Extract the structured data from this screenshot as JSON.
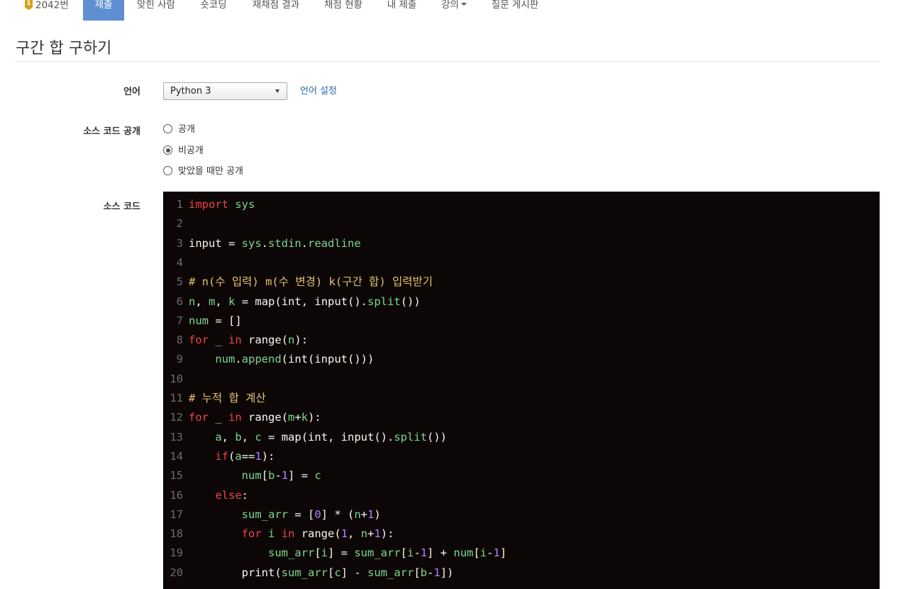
{
  "nav": {
    "problem_number": "2042번",
    "medal_text": "1",
    "items": [
      {
        "label": "제출",
        "active": true
      },
      {
        "label": "맞힌 사람"
      },
      {
        "label": "숏코딩"
      },
      {
        "label": "재채점 결과"
      },
      {
        "label": "채점 현황"
      },
      {
        "label": "내 제출"
      },
      {
        "label": "강의"
      },
      {
        "label": "질문 게시판"
      }
    ]
  },
  "page": {
    "title": "구간 합 구하기"
  },
  "form": {
    "language_label": "언어",
    "language_value": "Python 3",
    "language_settings_link": "언어 설정",
    "source_visibility_label": "소스 코드 공개",
    "visibility_options": [
      {
        "label": "공개",
        "checked": false
      },
      {
        "label": "비공개",
        "checked": true
      },
      {
        "label": "맞았을 때만 공개",
        "checked": false
      }
    ],
    "source_code_label": "소스 코드"
  },
  "code_lines": [
    {
      "n": "1",
      "segs": [
        [
          "import",
          "kw"
        ],
        [
          " "
        ],
        [
          "sys",
          "v"
        ]
      ]
    },
    {
      "n": "2",
      "segs": []
    },
    {
      "n": "3",
      "segs": [
        [
          "input = "
        ],
        [
          "sys",
          "v"
        ],
        [
          "."
        ],
        [
          "stdin",
          "v"
        ],
        [
          "."
        ],
        [
          "readline",
          "v"
        ]
      ]
    },
    {
      "n": "4",
      "segs": []
    },
    {
      "n": "5",
      "segs": [
        [
          "# n(수 입력) m(수 변경) k(구간 합) 입력받기",
          "cm"
        ]
      ]
    },
    {
      "n": "6",
      "segs": [
        [
          "n",
          "v"
        ],
        [
          ", "
        ],
        [
          "m",
          "v"
        ],
        [
          ", "
        ],
        [
          "k",
          "v"
        ],
        [
          " = map(int, input()."
        ],
        [
          "split",
          "v"
        ],
        [
          "())"
        ]
      ]
    },
    {
      "n": "7",
      "segs": [
        [
          "num",
          "v"
        ],
        [
          " = []"
        ]
      ]
    },
    {
      "n": "8",
      "segs": [
        [
          "for",
          "kw"
        ],
        [
          " "
        ],
        [
          "_",
          "v"
        ],
        [
          " "
        ],
        [
          "in",
          "kw"
        ],
        [
          " range("
        ],
        [
          "n",
          "v"
        ],
        [
          "):"
        ]
      ]
    },
    {
      "n": "9",
      "segs": [
        [
          "    "
        ],
        [
          "num",
          "v"
        ],
        [
          "."
        ],
        [
          "append",
          "v"
        ],
        [
          "(int(input()))"
        ]
      ]
    },
    {
      "n": "10",
      "segs": []
    },
    {
      "n": "11",
      "segs": [
        [
          "# 누적 합 계산",
          "cm"
        ]
      ]
    },
    {
      "n": "12",
      "segs": [
        [
          "for",
          "kw"
        ],
        [
          " "
        ],
        [
          "_",
          "v"
        ],
        [
          " "
        ],
        [
          "in",
          "kw"
        ],
        [
          " range("
        ],
        [
          "m",
          "v"
        ],
        [
          "+"
        ],
        [
          "k",
          "v"
        ],
        [
          "):"
        ]
      ]
    },
    {
      "n": "13",
      "segs": [
        [
          "    "
        ],
        [
          "a",
          "v"
        ],
        [
          ", "
        ],
        [
          "b",
          "v"
        ],
        [
          ", "
        ],
        [
          "c",
          "v"
        ],
        [
          " = map(int, input()."
        ],
        [
          "split",
          "v"
        ],
        [
          "())"
        ]
      ]
    },
    {
      "n": "14",
      "segs": [
        [
          "    "
        ],
        [
          "if",
          "kw"
        ],
        [
          "("
        ],
        [
          "a",
          "v"
        ],
        [
          "=="
        ],
        [
          "1",
          "n"
        ],
        [
          "):"
        ]
      ]
    },
    {
      "n": "15",
      "segs": [
        [
          "        "
        ],
        [
          "num",
          "v"
        ],
        [
          "["
        ],
        [
          "b",
          "v"
        ],
        [
          "-"
        ],
        [
          "1",
          "n"
        ],
        [
          "] = "
        ],
        [
          "c",
          "v"
        ]
      ]
    },
    {
      "n": "16",
      "segs": [
        [
          "    "
        ],
        [
          "else",
          "kw"
        ],
        [
          ":"
        ]
      ]
    },
    {
      "n": "17",
      "segs": [
        [
          "        "
        ],
        [
          "sum_arr",
          "v"
        ],
        [
          " = ["
        ],
        [
          "0",
          "n"
        ],
        [
          "] * ("
        ],
        [
          "n",
          "v"
        ],
        [
          "+"
        ],
        [
          "1",
          "n"
        ],
        [
          ")"
        ]
      ]
    },
    {
      "n": "18",
      "segs": [
        [
          "        "
        ],
        [
          "for",
          "kw"
        ],
        [
          " "
        ],
        [
          "i",
          "v"
        ],
        [
          " "
        ],
        [
          "in",
          "kw"
        ],
        [
          " range("
        ],
        [
          "1",
          "n"
        ],
        [
          ", "
        ],
        [
          "n",
          "v"
        ],
        [
          "+"
        ],
        [
          "1",
          "n"
        ],
        [
          "):"
        ]
      ]
    },
    {
      "n": "19",
      "segs": [
        [
          "            "
        ],
        [
          "sum_arr",
          "v"
        ],
        [
          "["
        ],
        [
          "i",
          "v"
        ],
        [
          "] = "
        ],
        [
          "sum_arr",
          "v"
        ],
        [
          "["
        ],
        [
          "i",
          "v"
        ],
        [
          "-"
        ],
        [
          "1",
          "n"
        ],
        [
          "] + "
        ],
        [
          "num",
          "v"
        ],
        [
          "["
        ],
        [
          "i",
          "v"
        ],
        [
          "-"
        ],
        [
          "1",
          "n"
        ],
        [
          "]"
        ]
      ]
    },
    {
      "n": "20",
      "segs": [
        [
          "        print("
        ],
        [
          "sum_arr",
          "v"
        ],
        [
          "["
        ],
        [
          "c",
          "v"
        ],
        [
          "] - "
        ],
        [
          "sum_arr",
          "v"
        ],
        [
          "["
        ],
        [
          "b",
          "v"
        ],
        [
          "-"
        ],
        [
          "1",
          "n"
        ],
        [
          "])"
        ]
      ]
    }
  ]
}
